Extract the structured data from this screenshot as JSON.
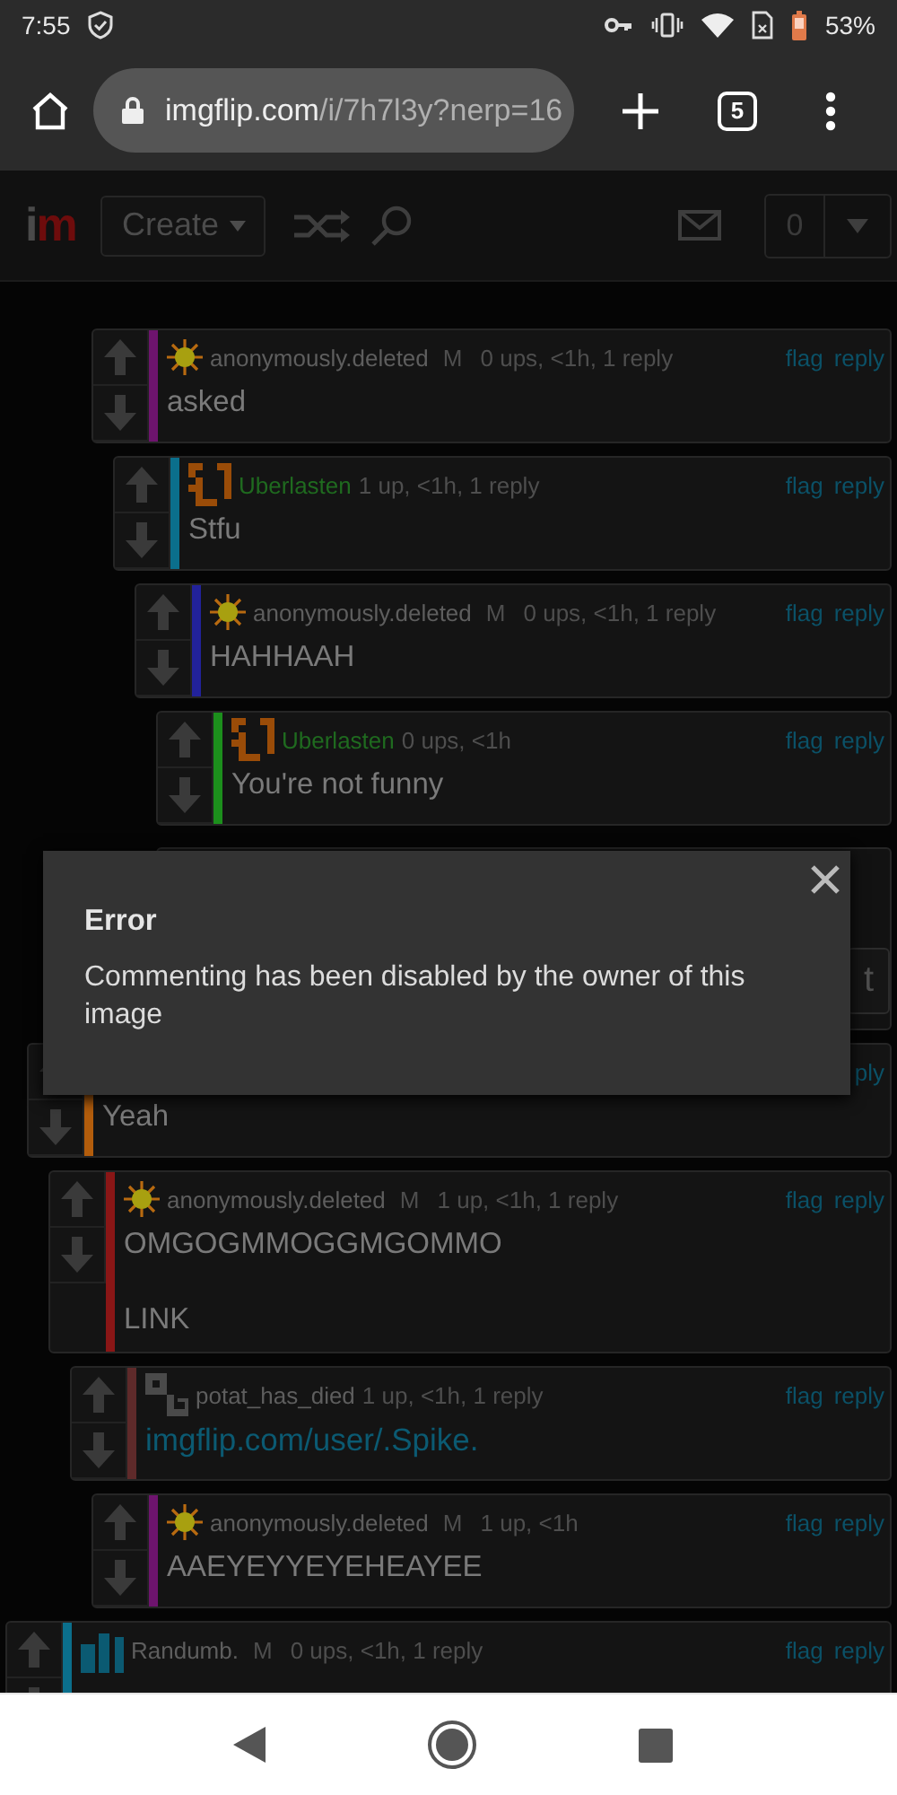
{
  "status_bar": {
    "time": "7:55",
    "battery": "53%"
  },
  "browser": {
    "url_host": "imgflip.com",
    "url_path": "/i/7h7l3y?nerp=16",
    "tab_count": "5"
  },
  "site_nav": {
    "logo": [
      "i",
      "m"
    ],
    "create": "Create",
    "notifications": "0"
  },
  "threads": [
    [
      {
        "kind": "comment",
        "avatar": {
          "kind": "sun"
        },
        "user": {
          "name": "anonymously.deleted",
          "color": "#5e5e5e"
        },
        "mod": "M",
        "stats": "0 ups, <1h, 1 reply",
        "actions": [
          "flag",
          "reply"
        ],
        "color": "#6e146e",
        "body": [
          {
            "kind": "text",
            "text": "asked"
          }
        ],
        "children": [
          {
            "kind": "comment",
            "avatar": {
              "kind": "u-pixel"
            },
            "user": {
              "name": "Uberlasten",
              "color": "#1f6a1f"
            },
            "stats": "1 up, <1h, 1 reply",
            "actions": [
              "flag",
              "reply"
            ],
            "color": "#0b6f8c",
            "body": [
              {
                "kind": "text",
                "text": "Stfu"
              }
            ],
            "children": [
              {
                "kind": "comment",
                "avatar": {
                  "kind": "sun"
                },
                "user": {
                  "name": "anonymously.deleted",
                  "color": "#5e5e5e"
                },
                "mod": "M",
                "stats": "0 ups, <1h, 1 reply",
                "actions": [
                  "flag",
                  "reply"
                ],
                "color": "#22229a",
                "body": [
                  {
                    "kind": "text",
                    "text": "HAHHAAH"
                  }
                ],
                "children": [
                  {
                    "kind": "comment",
                    "avatar": {
                      "kind": "u-pixel"
                    },
                    "user": {
                      "name": "Uberlasten",
                      "color": "#1f6a1f"
                    },
                    "stats": "0 ups, <1h",
                    "actions": [
                      "flag",
                      "reply"
                    ],
                    "color": "#1c8f1c",
                    "body": [
                      {
                        "kind": "text",
                        "text": "You're not funny"
                      }
                    ]
                  },
                  {
                    "kind": "reply_form",
                    "button": "t"
                  }
                ]
              }
            ]
          }
        ]
      }
    ],
    [
      {
        "kind": "comment",
        "actions": [
          "ply"
        ],
        "color": "#b35d0c",
        "body": [
          {
            "kind": "text",
            "text": "Yeah"
          }
        ],
        "children": [
          {
            "kind": "comment",
            "avatar": {
              "kind": "sun"
            },
            "user": {
              "name": "anonymously.deleted",
              "color": "#5e5e5e"
            },
            "mod": "M",
            "stats": "1 up, <1h, 1 reply",
            "actions": [
              "flag",
              "reply"
            ],
            "color": "#8a1616",
            "body": [
              {
                "kind": "text",
                "text": "OMGOGMMOGGMGOMMO"
              },
              {
                "kind": "text",
                "text": "LINK"
              }
            ],
            "children": [
              {
                "kind": "comment",
                "avatar": {
                  "kind": "pixel-p"
                },
                "user": {
                  "name": "potat_has_died",
                  "color": "#5e5e5e"
                },
                "stats": "1 up, <1h, 1 reply",
                "actions": [
                  "flag",
                  "reply"
                ],
                "color": "#5e2a2a",
                "body": [
                  {
                    "kind": "link",
                    "text": "imgflip.com/user/.Spike."
                  }
                ],
                "children": [
                  {
                    "kind": "comment",
                    "avatar": {
                      "kind": "sun"
                    },
                    "user": {
                      "name": "anonymously.deleted",
                      "color": "#5e5e5e"
                    },
                    "mod": "M",
                    "stats": "1 up, <1h",
                    "actions": [
                      "flag",
                      "reply"
                    ],
                    "color": "#6e146e",
                    "body": [
                      {
                        "kind": "text",
                        "text": "AAEYEYYEYEHEAYEE"
                      }
                    ]
                  }
                ]
              }
            ]
          }
        ]
      }
    ],
    [
      {
        "kind": "comment",
        "avatar": {
          "kind": "bars"
        },
        "user": {
          "name": "Randumb.",
          "color": "#5e5e5e"
        },
        "mod": "M",
        "stats": "0 ups, <1h, 1 reply",
        "actions": [
          "flag",
          "reply"
        ],
        "color": "#0b6f8c"
      }
    ]
  ],
  "dialog": {
    "title": "Error",
    "message": "Commenting has been disabled by the owner of this image"
  }
}
